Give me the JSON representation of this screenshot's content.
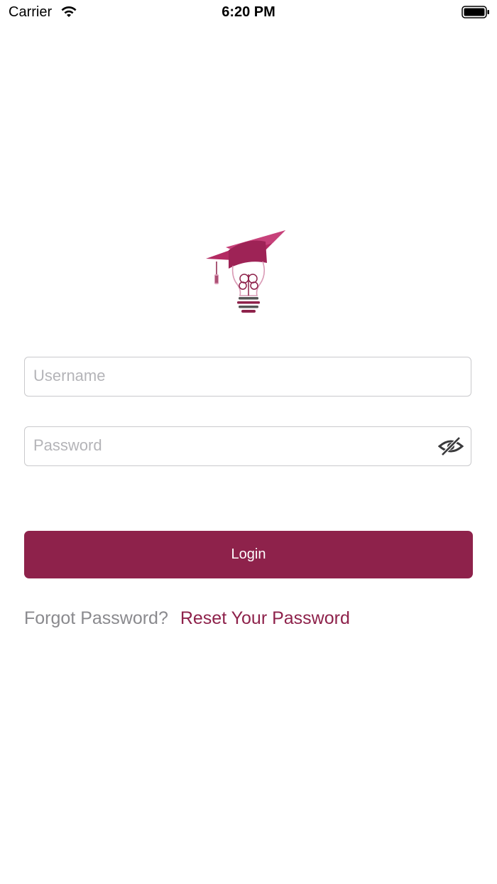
{
  "status_bar": {
    "carrier": "Carrier",
    "time": "6:20 PM",
    "wifi_icon": "wifi-icon",
    "battery_icon": "battery-full-icon"
  },
  "logo": {
    "icon": "graduation-cap-lightbulb-logo"
  },
  "login_form": {
    "username_placeholder": "Username",
    "username_value": "",
    "password_placeholder": "Password",
    "password_value": "",
    "password_toggle_icon": "eye-slash-icon",
    "login_label": "Login"
  },
  "forgot": {
    "prompt": "Forgot Password?",
    "link_label": "Reset Your Password"
  },
  "colors": {
    "brand": "#8e224b",
    "muted_text": "#8a8a8e",
    "border": "#c9c9cc"
  }
}
